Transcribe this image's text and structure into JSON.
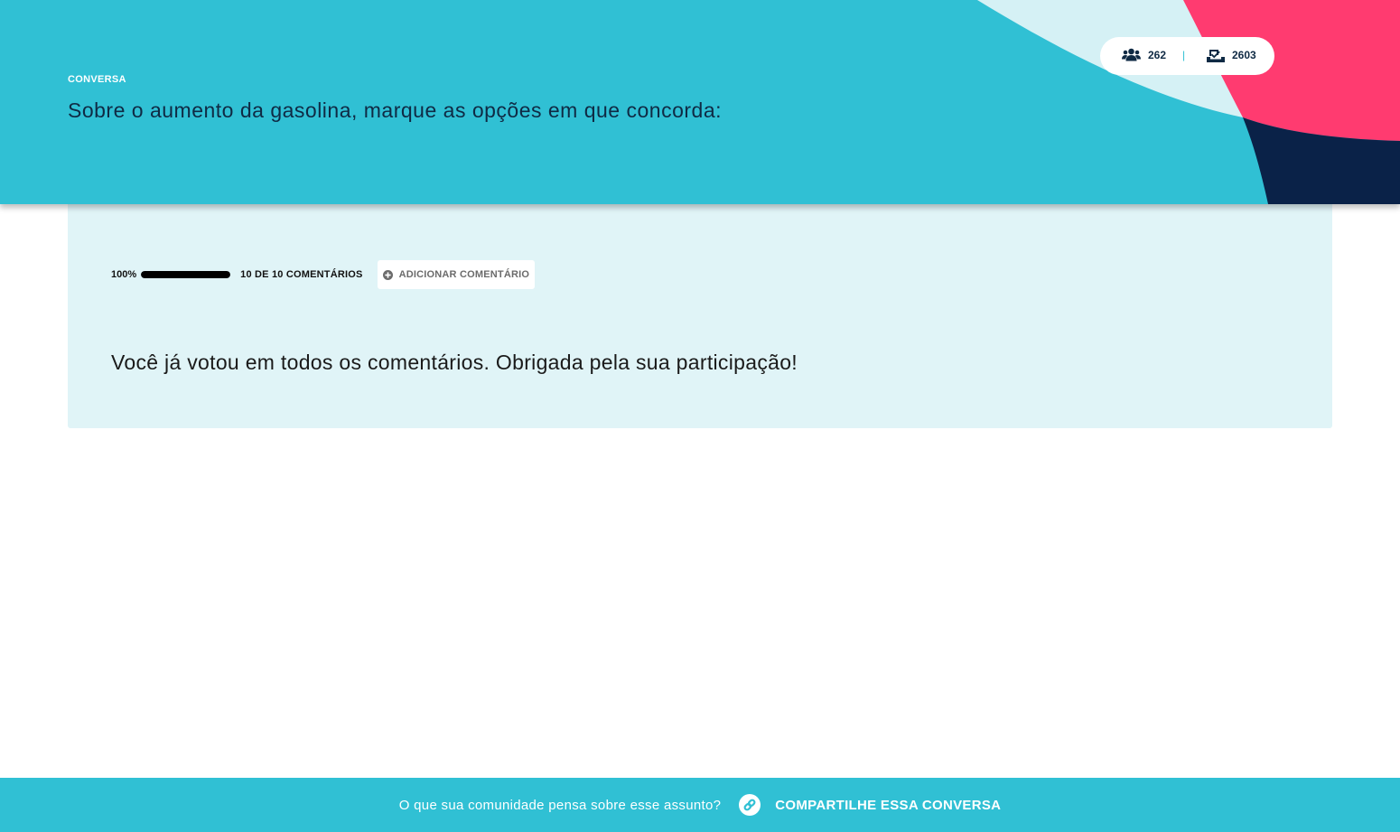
{
  "header": {
    "label": "CONVERSA",
    "title": "Sobre o aumento da gasolina, marque as opções em que concorda:",
    "stats": {
      "participants_icon": "users-icon",
      "participants": "262",
      "divider": "|",
      "votes_icon": "ballot-check-icon",
      "votes": "2603"
    }
  },
  "progress": {
    "percent_label": "100%",
    "fraction": 1.0,
    "count_label": "10 DE 10 COMENTÁRIOS"
  },
  "add_comment": {
    "icon": "plus-circle-icon",
    "label": "ADICIONAR COMENTÁRIO"
  },
  "message": "Você já votou em todos os comentários. Obrigada pela sua participação!",
  "footer": {
    "question": "O que sua comunidade pensa sobre esse assunto?",
    "share_icon": "link-icon",
    "share_label": "COMPARTILHE ESSA CONVERSA"
  },
  "colors": {
    "primary": "#30c0d4",
    "accent_pink": "#ff3b70",
    "navy": "#0a2248",
    "light_cyan": "#d5f1f5",
    "card_background": "#e0f4f7",
    "text_dark": "#0f2a44"
  }
}
